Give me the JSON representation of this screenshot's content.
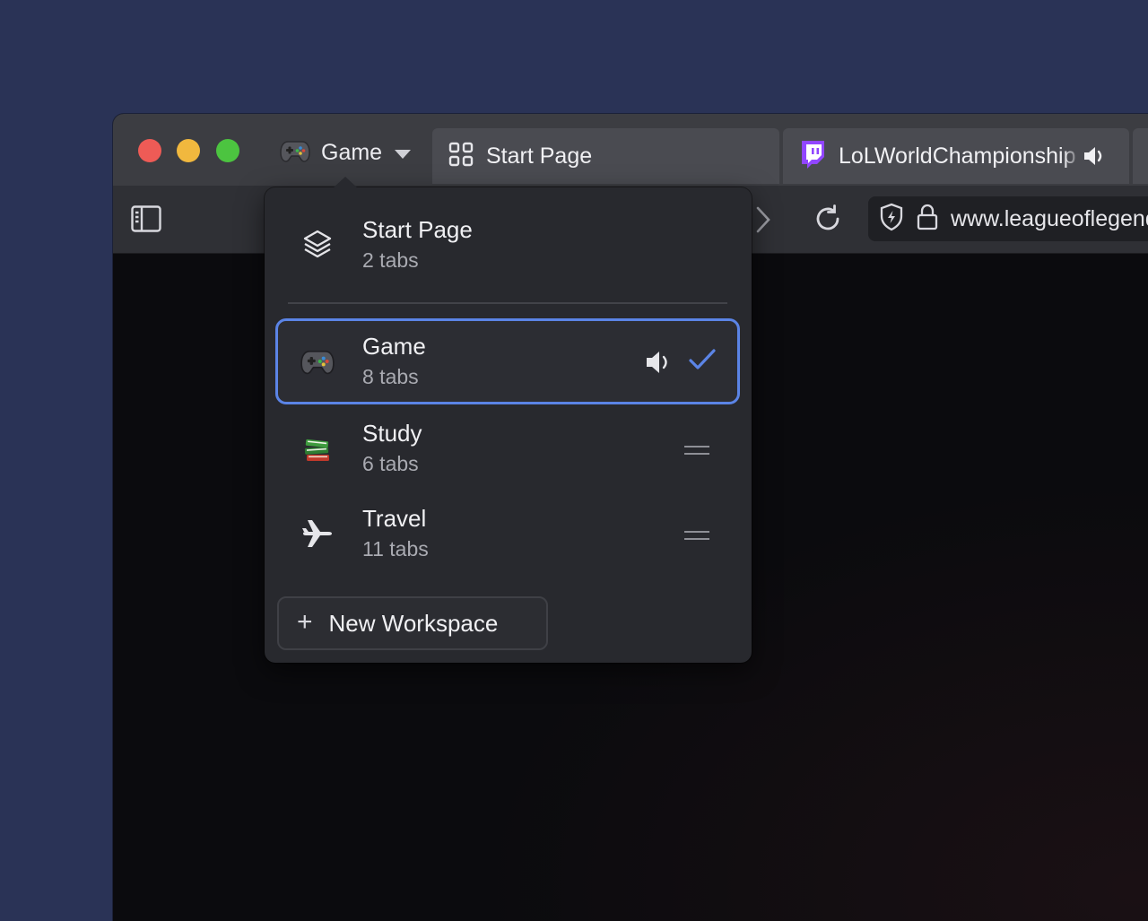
{
  "window": {
    "controls": [
      "close",
      "minimize",
      "zoom"
    ]
  },
  "workspace_switcher": {
    "label": "Game",
    "icon": "gamepad-icon"
  },
  "tabs": [
    {
      "title": "Start Page",
      "icon": "grid-icon"
    },
    {
      "title": "LoLWorldChampionship",
      "icon": "twitch-icon",
      "audio": true
    },
    {
      "title": "",
      "icon": ""
    }
  ],
  "toolbar": {
    "sidebar_icon": "sidebar-icon",
    "forward_icon": "chevron-right-icon",
    "reload_icon": "reload-icon",
    "address": {
      "url": "www.leagueoflegends.com",
      "shield_icon": "shield-icon",
      "lock_icon": "lock-icon"
    }
  },
  "popover": {
    "workspaces": [
      {
        "name": "Start Page",
        "count": "2 tabs",
        "icon": "layers-icon"
      },
      {
        "name": "Game",
        "count": "8 tabs",
        "icon": "gamepad-icon",
        "selected": true,
        "audio": true
      },
      {
        "name": "Study",
        "count": "6 tabs",
        "icon": "books-icon"
      },
      {
        "name": "Travel",
        "count": "11 tabs",
        "icon": "airplane-icon"
      }
    ],
    "new_workspace": {
      "label": "New Workspace",
      "icon": "plus"
    }
  },
  "colors": {
    "background": "#2a3356",
    "accent": "#5b84e6",
    "twitch": "#9146ff"
  }
}
